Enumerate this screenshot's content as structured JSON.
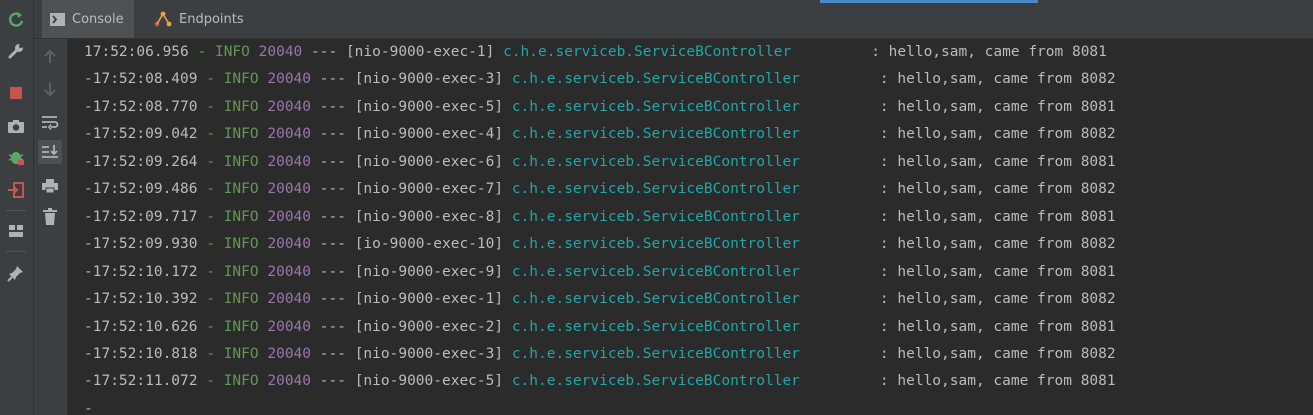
{
  "tabs": [
    {
      "label": "Console",
      "icon": "console-icon",
      "active": true
    },
    {
      "label": "Endpoints",
      "icon": "endpoints-icon",
      "active": false
    }
  ],
  "left_toolbar": [
    {
      "name": "rerun-icon",
      "color": "#59a869"
    },
    {
      "name": "wrench-icon",
      "color": "#afb1b3"
    },
    {
      "name": "stop-icon",
      "color": "#c75450"
    },
    {
      "name": "camera-icon",
      "color": "#afb1b3"
    },
    {
      "name": "debug-icon",
      "color": "#59a869"
    },
    {
      "name": "exit-icon",
      "color": "#c75450"
    },
    {
      "name": "layout-icon",
      "color": "#afb1b3"
    },
    {
      "name": "pin-icon",
      "color": "#afb1b3"
    }
  ],
  "side_toolbar": [
    {
      "name": "up-arrow-icon",
      "active": false
    },
    {
      "name": "down-arrow-icon",
      "active": false
    },
    {
      "name": "soft-wrap-icon",
      "active": false
    },
    {
      "name": "scroll-to-end-icon",
      "active": true
    },
    {
      "name": "print-icon",
      "active": false
    },
    {
      "name": "trash-icon",
      "active": false
    }
  ],
  "log": {
    "lines": [
      {
        "dash": "",
        "time": "17:52:06.956",
        "level": "INFO",
        "pid": "20040",
        "sep": "---",
        "thread": "[nio-9000-exec-1]",
        "logger": "c.h.e.serviceb.ServiceBController",
        "msg": ": hello,sam, came from 8081"
      },
      {
        "dash": "-",
        "time": "17:52:08.409",
        "level": "INFO",
        "pid": "20040",
        "sep": "---",
        "thread": "[nio-9000-exec-3]",
        "logger": "c.h.e.serviceb.ServiceBController",
        "msg": ": hello,sam, came from 8082"
      },
      {
        "dash": "-",
        "time": "17:52:08.770",
        "level": "INFO",
        "pid": "20040",
        "sep": "---",
        "thread": "[nio-9000-exec-5]",
        "logger": "c.h.e.serviceb.ServiceBController",
        "msg": ": hello,sam, came from 8081"
      },
      {
        "dash": "-",
        "time": "17:52:09.042",
        "level": "INFO",
        "pid": "20040",
        "sep": "---",
        "thread": "[nio-9000-exec-4]",
        "logger": "c.h.e.serviceb.ServiceBController",
        "msg": ": hello,sam, came from 8082"
      },
      {
        "dash": "-",
        "time": "17:52:09.264",
        "level": "INFO",
        "pid": "20040",
        "sep": "---",
        "thread": "[nio-9000-exec-6]",
        "logger": "c.h.e.serviceb.ServiceBController",
        "msg": ": hello,sam, came from 8081"
      },
      {
        "dash": "-",
        "time": "17:52:09.486",
        "level": "INFO",
        "pid": "20040",
        "sep": "---",
        "thread": "[nio-9000-exec-7]",
        "logger": "c.h.e.serviceb.ServiceBController",
        "msg": ": hello,sam, came from 8082"
      },
      {
        "dash": "-",
        "time": "17:52:09.717",
        "level": "INFO",
        "pid": "20040",
        "sep": "---",
        "thread": "[nio-9000-exec-8]",
        "logger": "c.h.e.serviceb.ServiceBController",
        "msg": ": hello,sam, came from 8081"
      },
      {
        "dash": "-",
        "time": "17:52:09.930",
        "level": "INFO",
        "pid": "20040",
        "sep": "---",
        "thread": "[io-9000-exec-10]",
        "logger": "c.h.e.serviceb.ServiceBController",
        "msg": ": hello,sam, came from 8082"
      },
      {
        "dash": "-",
        "time": "17:52:10.172",
        "level": "INFO",
        "pid": "20040",
        "sep": "---",
        "thread": "[nio-9000-exec-9]",
        "logger": "c.h.e.serviceb.ServiceBController",
        "msg": ": hello,sam, came from 8081"
      },
      {
        "dash": "-",
        "time": "17:52:10.392",
        "level": "INFO",
        "pid": "20040",
        "sep": "---",
        "thread": "[nio-9000-exec-1]",
        "logger": "c.h.e.serviceb.ServiceBController",
        "msg": ": hello,sam, came from 8082"
      },
      {
        "dash": "-",
        "time": "17:52:10.626",
        "level": "INFO",
        "pid": "20040",
        "sep": "---",
        "thread": "[nio-9000-exec-2]",
        "logger": "c.h.e.serviceb.ServiceBController",
        "msg": ": hello,sam, came from 8081"
      },
      {
        "dash": "-",
        "time": "17:52:10.818",
        "level": "INFO",
        "pid": "20040",
        "sep": "---",
        "thread": "[nio-9000-exec-3]",
        "logger": "c.h.e.serviceb.ServiceBController",
        "msg": ": hello,sam, came from 8082"
      },
      {
        "dash": "-",
        "time": "17:52:11.072",
        "level": "INFO",
        "pid": "20040",
        "sep": "---",
        "thread": "[nio-9000-exec-5]",
        "logger": "c.h.e.serviceb.ServiceBController",
        "msg": ": hello,sam, came from 8081"
      }
    ],
    "trailing_dash": "-"
  }
}
